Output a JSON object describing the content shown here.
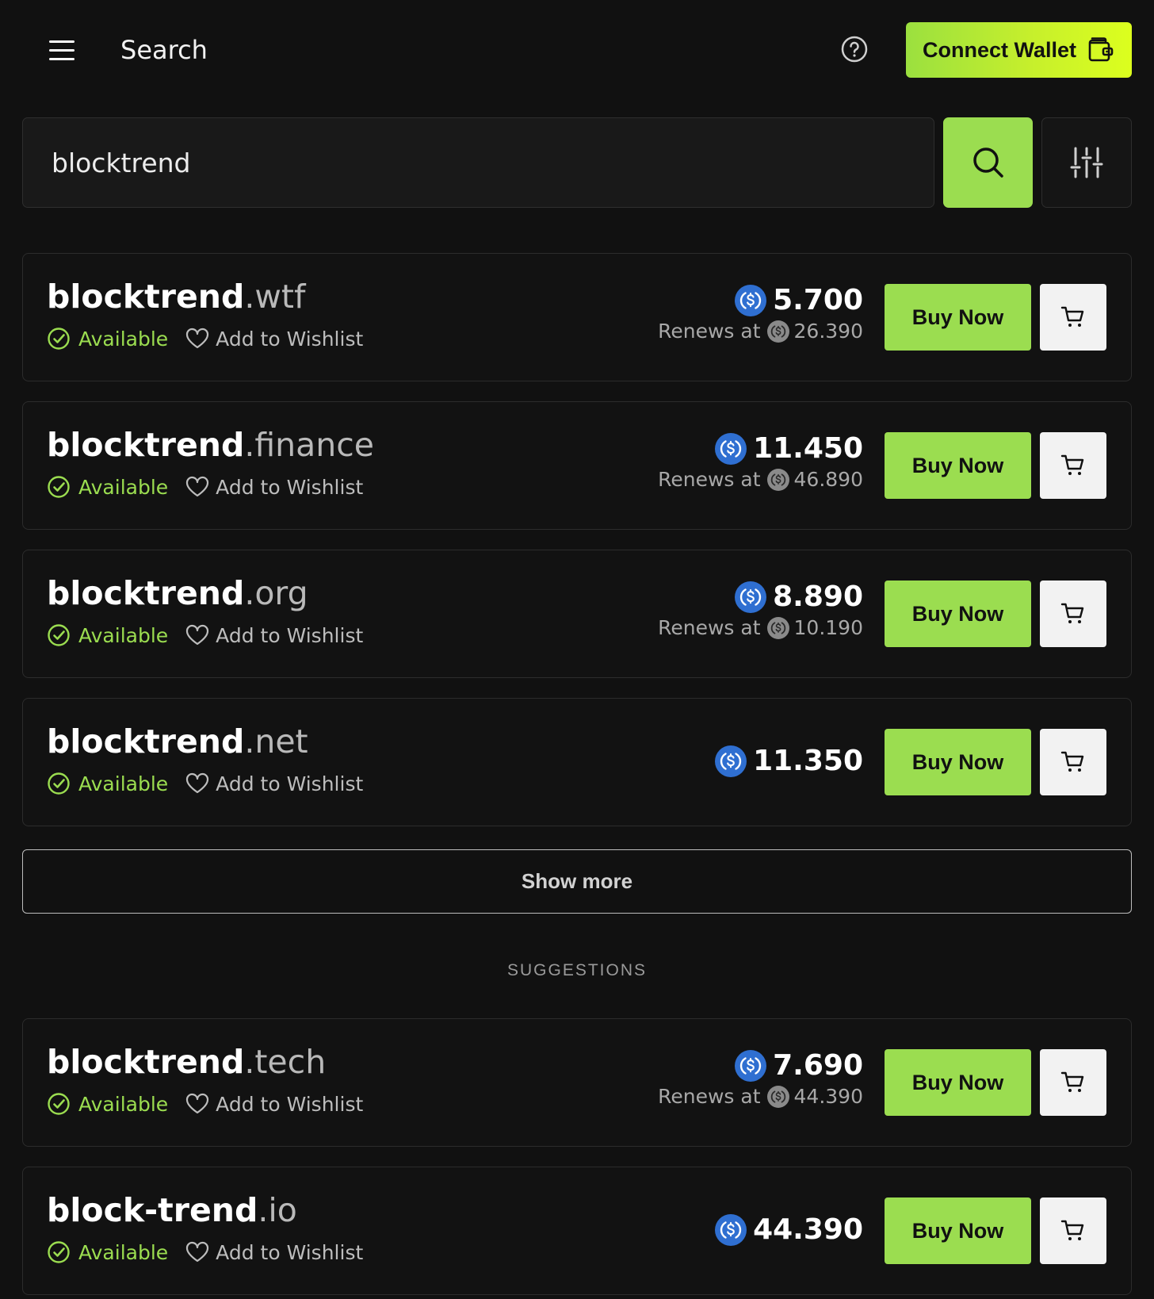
{
  "header": {
    "title": "Search",
    "connect_label": "Connect Wallet"
  },
  "search": {
    "value": "blocktrend",
    "placeholder": ""
  },
  "results": [
    {
      "base": "blocktrend",
      "tld": ".wtf",
      "status": "Available",
      "wishlist": "Add to Wishlist",
      "price": "5.700",
      "renew_label": "Renews at",
      "renew_price": "26.390",
      "buy_label": "Buy Now"
    },
    {
      "base": "blocktrend",
      "tld": ".finance",
      "status": "Available",
      "wishlist": "Add to Wishlist",
      "price": "11.450",
      "renew_label": "Renews at",
      "renew_price": "46.890",
      "buy_label": "Buy Now"
    },
    {
      "base": "blocktrend",
      "tld": ".org",
      "status": "Available",
      "wishlist": "Add to Wishlist",
      "price": "8.890",
      "renew_label": "Renews at",
      "renew_price": "10.190",
      "buy_label": "Buy Now"
    },
    {
      "base": "blocktrend",
      "tld": ".net",
      "status": "Available",
      "wishlist": "Add to Wishlist",
      "price": "11.350",
      "buy_label": "Buy Now"
    }
  ],
  "show_more_label": "Show more",
  "suggestions_label": "SUGGESTIONS",
  "suggestions": [
    {
      "base": "blocktrend",
      "tld": ".tech",
      "status": "Available",
      "wishlist": "Add to Wishlist",
      "price": "7.690",
      "renew_label": "Renews at",
      "renew_price": "44.390",
      "buy_label": "Buy Now"
    },
    {
      "base": "block-trend",
      "tld": ".io",
      "status": "Available",
      "wishlist": "Add to Wishlist",
      "price": "44.390",
      "buy_label": "Buy Now"
    }
  ],
  "colors": {
    "background": "#111111",
    "accent": "#9bdd50",
    "wallet_gradient_end": "#dcff1e",
    "coin_blue": "#2f6fd1"
  },
  "icons": [
    "menu-icon",
    "help-icon",
    "wallet-icon",
    "search-icon",
    "filter-icon",
    "check-circle-icon",
    "heart-icon",
    "usdc-coin-icon",
    "cart-icon"
  ]
}
